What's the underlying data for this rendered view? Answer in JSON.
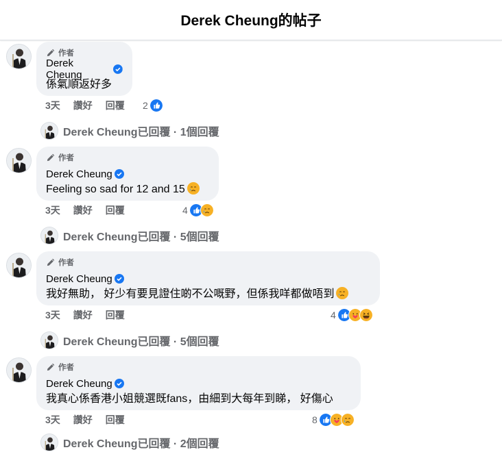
{
  "header": {
    "title": "Derek Cheung的帖子"
  },
  "author_badge": "作者",
  "comments": [
    {
      "name": "Derek Cheung",
      "text": "係氣順返好多",
      "time": "3天",
      "like": "讚好",
      "reply": "回覆",
      "reaction_count": "2",
      "reactions": [
        "like-icon"
      ],
      "reply_summary": "Derek Cheung已回覆 · 1個回覆"
    },
    {
      "name": "Derek Cheung",
      "text": "Feeling so sad for 12 and 15",
      "text_emoji": "sad-tear-emoji",
      "time": "3天",
      "like": "讚好",
      "reply": "回覆",
      "reaction_count": "4",
      "reactions": [
        "like-icon",
        "sad-icon"
      ],
      "reply_summary": "Derek Cheung已回覆 · 5個回覆"
    },
    {
      "name": "Derek Cheung",
      "text": "我好無助， 好少有要見證住啲不公嘅野，但係我咩都做唔到",
      "text_emoji": "sad-tear-emoji",
      "time": "3天",
      "like": "讚好",
      "reply": "回覆",
      "reaction_count": "4",
      "reactions": [
        "like-icon",
        "care-icon",
        "haha-icon"
      ],
      "reply_summary": "Derek Cheung已回覆 · 5個回覆"
    },
    {
      "name": "Derek Cheung",
      "text": "我真心係香港小姐競選既fans，由細到大每年到睇， 好傷心",
      "time": "3天",
      "like": "讚好",
      "reply": "回覆",
      "reaction_count": "8",
      "reactions": [
        "like-icon",
        "care-icon",
        "sad-icon"
      ],
      "reply_summary": "Derek Cheung已回覆 · 2個回覆"
    }
  ],
  "colors": {
    "like_blue": "#1877f2",
    "bubble_bg": "#f0f2f5",
    "secondary_text": "#65676b"
  }
}
